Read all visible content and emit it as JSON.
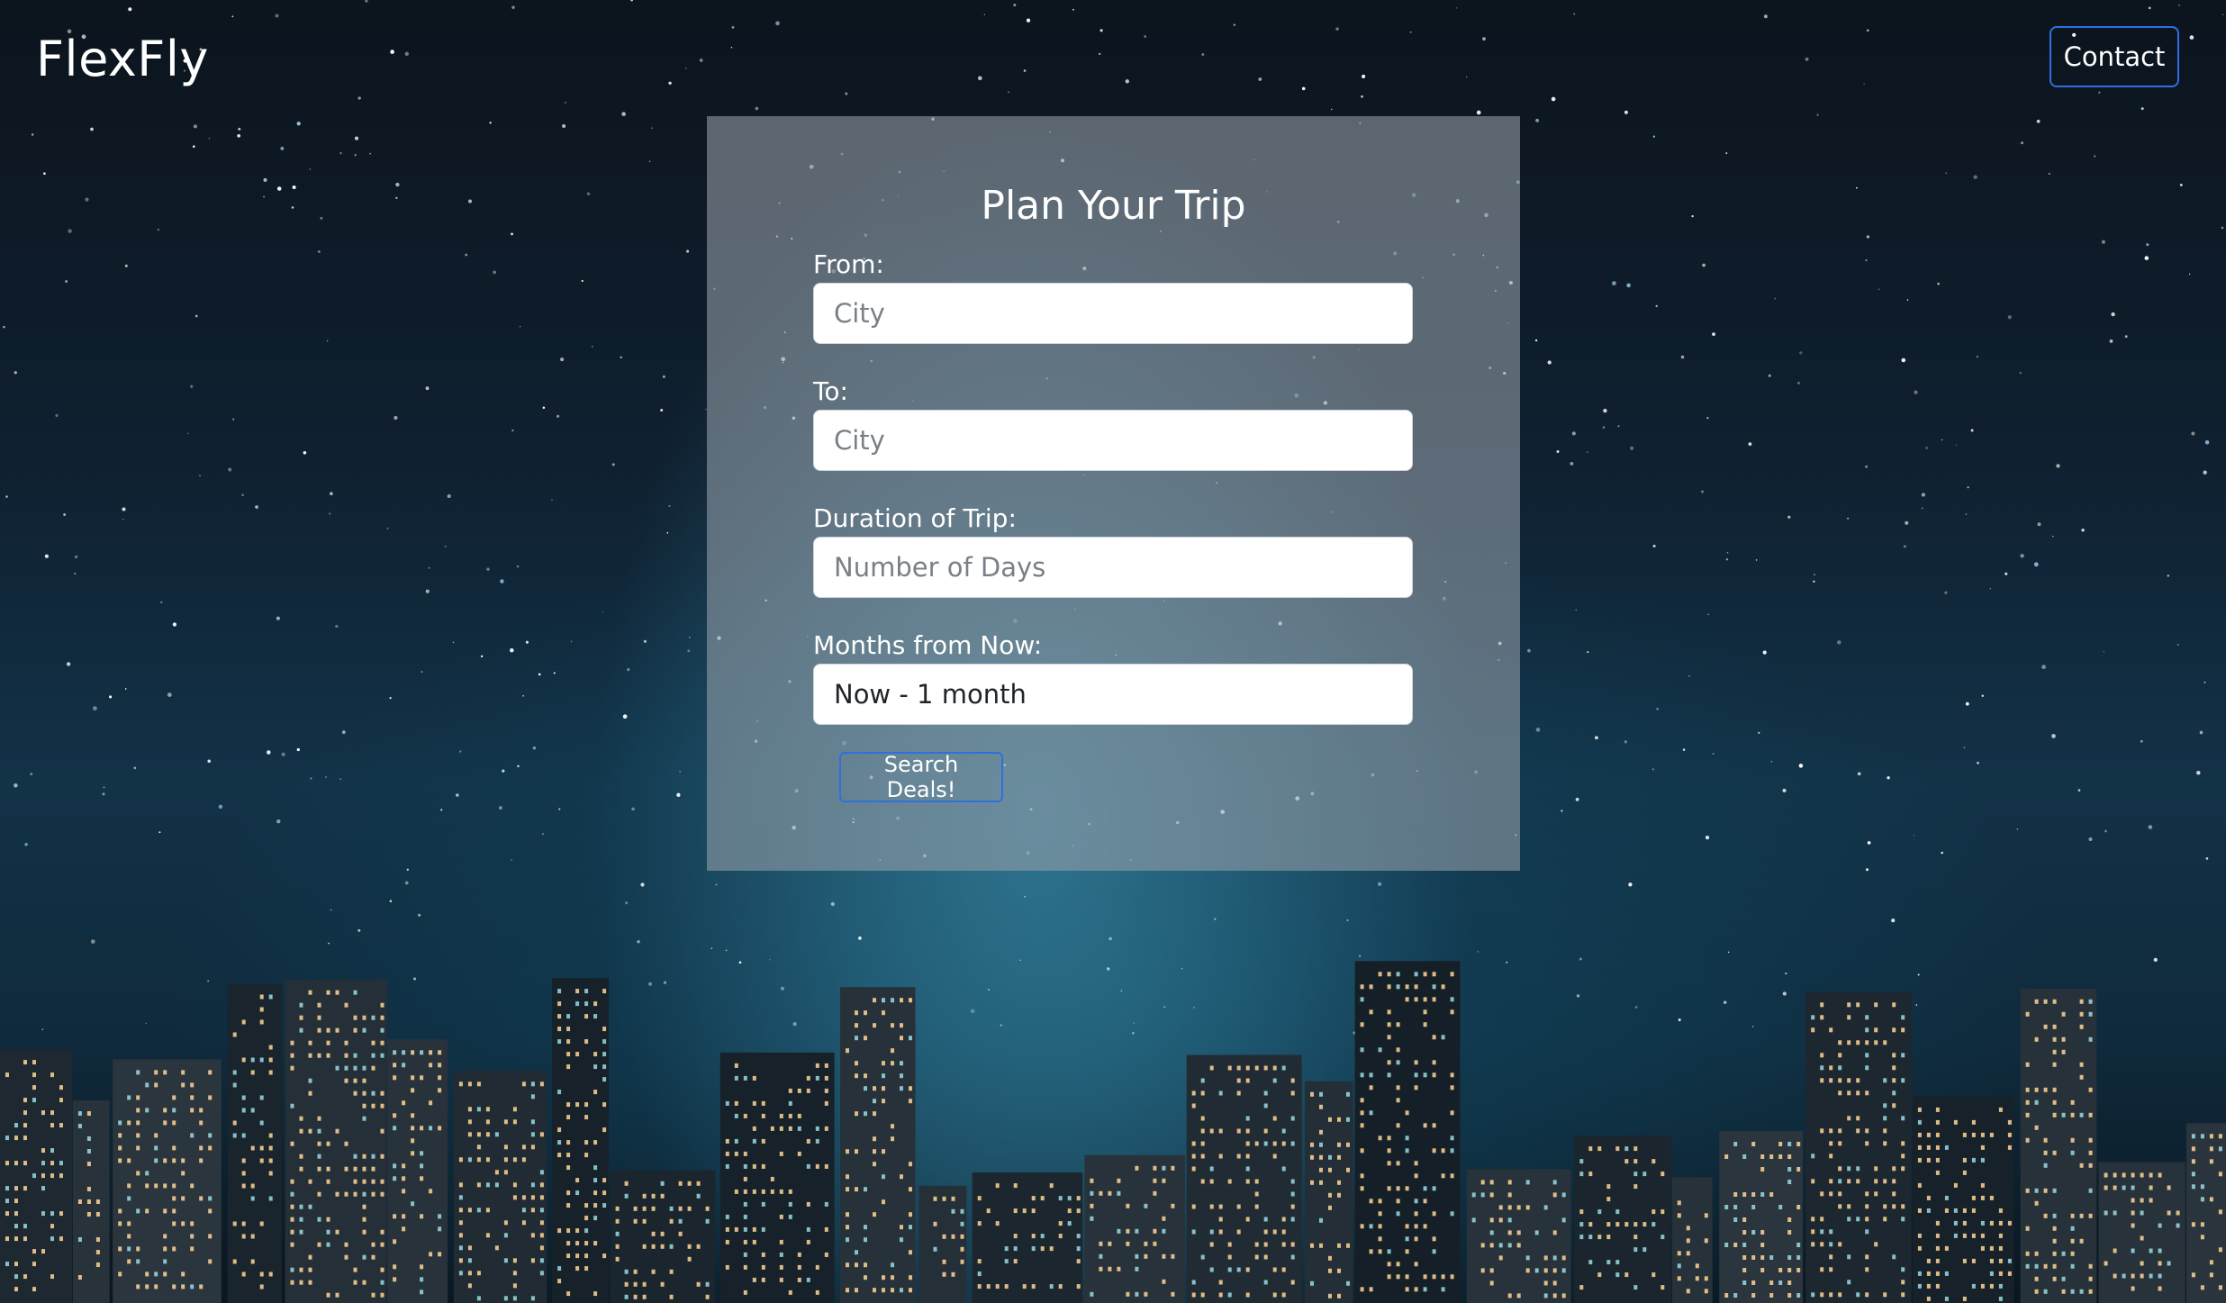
{
  "header": {
    "brand": "FlexFly",
    "contact_label": "Contact"
  },
  "form": {
    "title": "Plan Your Trip",
    "from": {
      "label": "From:",
      "placeholder": "City",
      "value": ""
    },
    "to": {
      "label": "To:",
      "placeholder": "City",
      "value": ""
    },
    "duration": {
      "label": "Duration of Trip:",
      "placeholder": "Number of Days",
      "value": ""
    },
    "months": {
      "label": "Months from Now:",
      "selected": "Now - 1 month"
    },
    "submit_label": "Search Deals!"
  },
  "colors": {
    "accent_border": "#2f6fe0",
    "card_background": "rgba(150,160,170,0.58)",
    "text": "#ffffff"
  }
}
